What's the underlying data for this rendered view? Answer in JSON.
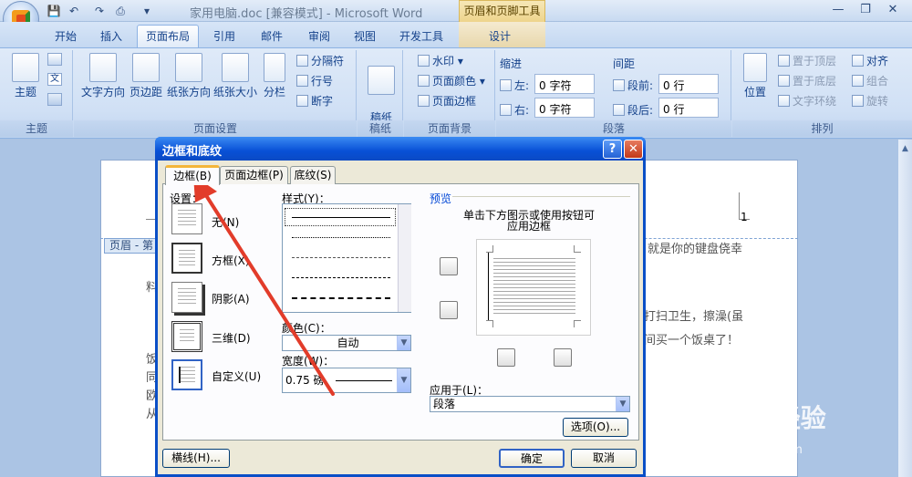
{
  "window": {
    "title": "家用电脑.doc [兼容模式] - Microsoft Word",
    "context_tab": "页眉和页脚工具",
    "context_sub_tab": "设计"
  },
  "tabs": [
    "开始",
    "插入",
    "页面布局",
    "引用",
    "邮件",
    "审阅",
    "视图",
    "开发工具"
  ],
  "active_tab": "页面布局",
  "ribbon": {
    "theme": {
      "label": "主题",
      "group": "主题"
    },
    "page_setup": {
      "group": "页面设置",
      "text_direction": "文字方向",
      "margins": "页边距",
      "orientation": "纸张方向",
      "size": "纸张大小",
      "columns": "分栏",
      "breaks": "分隔符",
      "line_numbers": "行号",
      "hyphenation": "断字"
    },
    "manuscript": {
      "group": "稿纸",
      "label": "稿纸\n设置"
    },
    "page_background": {
      "group": "页面背景",
      "watermark": "水印",
      "page_color": "页面颜色",
      "page_borders": "页面边框"
    },
    "paragraph": {
      "group": "段落",
      "indent": "缩进",
      "left": "左:",
      "right": "右:",
      "left_value": "0 字符",
      "right_value": "0 字符",
      "spacing": "间距",
      "before": "段前:",
      "after": "段后:",
      "before_value": "0 行",
      "after_value": "0 行"
    },
    "arrange": {
      "group": "排列",
      "position": "位置",
      "bring_front": "置于顶层",
      "send_back": "置于底层",
      "text_wrap": "文字环绕",
      "align": "对齐",
      "group_btn": "组合",
      "rotate": "旋转"
    }
  },
  "document": {
    "header_tag": "页眉 - 第",
    "page_number": "1",
    "line1": "就是你的键盘侥幸",
    "line2": "打扫卫生，擦澡(虽",
    "line3": "间买一个饭桌了！",
    "left_chars": [
      "料",
      "饭",
      "同",
      "欧",
      "从"
    ]
  },
  "dialog": {
    "title": "边框和底纹",
    "help": "?",
    "close": "✕",
    "tabs": [
      "边框(B)",
      "页面边框(P)",
      "底纹(S)"
    ],
    "active_tab": "边框(B)",
    "setting_label": "设置：",
    "settings": [
      "无(N)",
      "方框(X)",
      "阴影(A)",
      "三维(D)",
      "自定义(U)"
    ],
    "style_label": "样式(Y)：",
    "color_label": "颜色(C)：",
    "color_value": "自动",
    "width_label": "宽度(W)：",
    "width_value": "0.75 磅",
    "preview_label": "预览",
    "preview_hint_1": "单击下方图示或使用按钮可",
    "preview_hint_2": "应用边框",
    "apply_label": "应用于(L)：",
    "apply_value": "段落",
    "options_button": "选项(O)...",
    "horizontal_line_button": "横线(H)...",
    "ok_button": "确定",
    "cancel_button": "取消"
  },
  "watermark": {
    "text": "Baidu经验",
    "url_text": "jingyan.baidu.com"
  },
  "colors": {
    "accent": "#0a4fc7",
    "arrow": "#e23c2a",
    "ribbon": "#d0e0f5"
  }
}
